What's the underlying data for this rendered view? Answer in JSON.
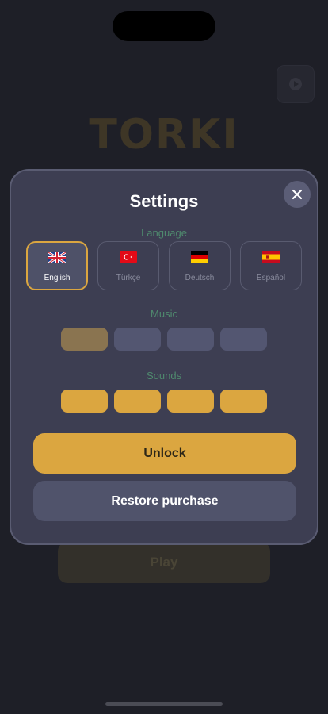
{
  "background": {
    "logo_text": "TORKI",
    "play_label": "Play"
  },
  "settings": {
    "title": "Settings",
    "language_label": "Language",
    "music_label": "Music",
    "sounds_label": "Sounds",
    "languages": [
      {
        "label": "English",
        "flag": "uk-flag-icon",
        "selected": true
      },
      {
        "label": "Türkçe",
        "flag": "turkey-flag-icon",
        "selected": false
      },
      {
        "label": "Deutsch",
        "flag": "germany-flag-icon",
        "selected": false
      },
      {
        "label": "Español",
        "flag": "spain-flag-icon",
        "selected": false
      }
    ],
    "music_level": 1,
    "music_max": 4,
    "sounds_level": 4,
    "sounds_max": 4,
    "unlock_label": "Unlock",
    "restore_label": "Restore purchase"
  },
  "colors": {
    "accent": "#dba640",
    "accent_dim": "#8a7450",
    "inactive_segment": "#535671",
    "modal_bg": "#3d3e52",
    "label_green": "#4f8a6e"
  }
}
